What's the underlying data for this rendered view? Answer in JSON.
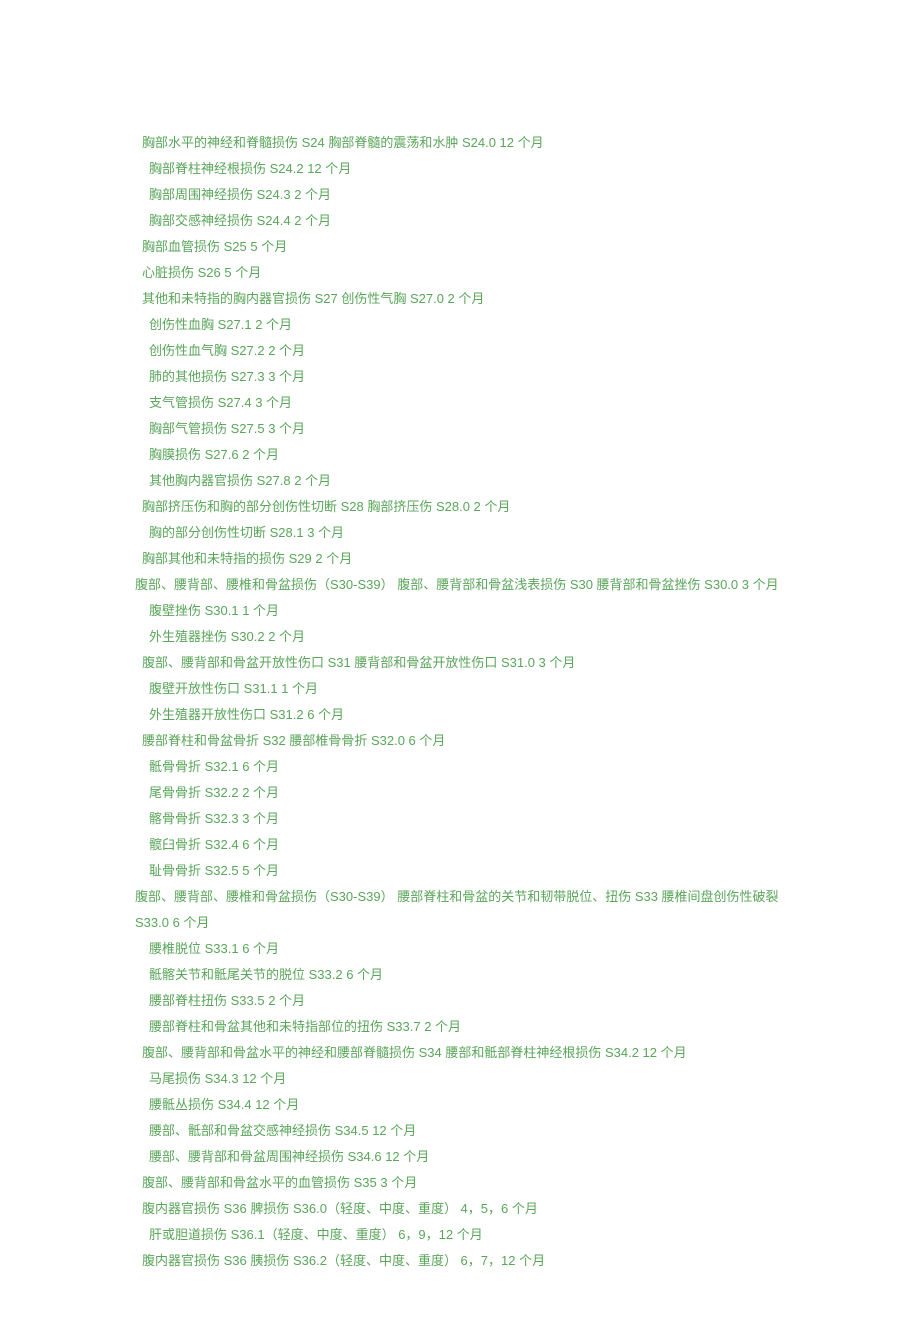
{
  "lines": [
    {
      "indent": 1,
      "parts": [
        "胸部水平的神经和脊髓损伤 S24 胸部脊髓的震荡和水肿 S24.0 12 个月"
      ]
    },
    {
      "indent": 2,
      "parts": [
        "胸部脊柱神经根损伤 S24.2 12 个月"
      ]
    },
    {
      "indent": 2,
      "parts": [
        "胸部周围神经损伤 S24.3 2 个月"
      ]
    },
    {
      "indent": 2,
      "parts": [
        "胸部交感神经损伤 S24.4 2 个月"
      ]
    },
    {
      "indent": 1,
      "parts": [
        "胸部血管损伤 S25 5 个月"
      ]
    },
    {
      "indent": 1,
      "parts": [
        "心脏损伤 S26 5 个月"
      ]
    },
    {
      "indent": 1,
      "parts": [
        "其他和未特指的胸内器官损伤 S27 创伤性气胸 S27.0 2 个月"
      ]
    },
    {
      "indent": 2,
      "parts": [
        "创伤性血胸 S27.1 2 个月"
      ]
    },
    {
      "indent": 2,
      "parts": [
        "创伤性血气胸 S27.2 2 个月"
      ]
    },
    {
      "indent": 2,
      "parts": [
        "肺的其他损伤 S27.3 3 个月"
      ]
    },
    {
      "indent": 2,
      "parts": [
        "支气管损伤 S27.4 3 个月"
      ]
    },
    {
      "indent": 2,
      "parts": [
        "胸部气管损伤 S27.5 3 个月"
      ]
    },
    {
      "indent": 2,
      "parts": [
        "胸膜损伤 S27.6 2 个月"
      ]
    },
    {
      "indent": 2,
      "parts": [
        "其他胸内器官损伤 S27.8 2 个月"
      ]
    },
    {
      "indent": 1,
      "parts": [
        "胸部挤压伤和胸的部分创伤性切断 S28 胸部挤压伤 S28.0 2 个月"
      ]
    },
    {
      "indent": 2,
      "parts": [
        "胸的部分创伤性切断 S28.1 3 个月"
      ]
    },
    {
      "indent": 1,
      "parts": [
        "胸部其他和未特指的损伤 S29 2 个月"
      ]
    },
    {
      "indent": 0,
      "parts": [
        "腹部、腰背部、腰椎和骨盆损伤（S30-S39） 腹部、腰背部和骨盆浅表损伤 S30 腰背部和骨盆挫伤 S30.0 3 个月"
      ]
    },
    {
      "indent": 2,
      "parts": [
        "腹壁挫伤 S30.1 1 个月"
      ]
    },
    {
      "indent": 2,
      "parts": [
        "外生殖器挫伤 S30.2 2 个月"
      ]
    },
    {
      "indent": 1,
      "parts": [
        "腹部、腰背部和骨盆开放性伤口 S31 腰背部和骨盆开放性伤口 S31.0 3 个月"
      ]
    },
    {
      "indent": 2,
      "parts": [
        "腹壁开放性伤口 S31.1 1 个月"
      ]
    },
    {
      "indent": 2,
      "parts": [
        "外生殖器开放性伤口 S31.2 6 个月"
      ]
    },
    {
      "indent": 1,
      "parts": [
        "腰部脊柱和骨盆骨折 S32 腰部椎骨骨折 S32.0 6 个月"
      ]
    },
    {
      "indent": 2,
      "parts": [
        "骶骨骨折 S32.1 6 个月"
      ]
    },
    {
      "indent": 2,
      "parts": [
        "尾骨骨折 S32.2 2 个月"
      ]
    },
    {
      "indent": 2,
      "parts": [
        "髂骨骨折 S32.3 3 个月"
      ]
    },
    {
      "indent": 2,
      "parts": [
        "髋臼骨折 S32.4 6 个月"
      ]
    },
    {
      "indent": 2,
      "parts": [
        "耻骨骨折 S32.5 5 个月"
      ]
    },
    {
      "indent": 0,
      "parts": [
        "腹部、腰背部、腰椎和骨盆损伤（S30-S39） 腰部脊柱和骨盆的关节和韧带脱位、扭伤 S33 腰椎间盘创伤性破裂"
      ]
    },
    {
      "indent": 0,
      "parts": [
        "S33.0 6 个月"
      ]
    },
    {
      "indent": 2,
      "parts": [
        "腰椎脱位 S33.1 6 个月"
      ]
    },
    {
      "indent": 2,
      "parts": [
        "骶髂关节和骶尾关节的脱位 S33.2 6 个月"
      ]
    },
    {
      "indent": 2,
      "parts": [
        "腰部脊柱扭伤 S33.5 2 个月"
      ]
    },
    {
      "indent": 2,
      "parts": [
        "腰部脊柱和骨盆其他和未特指部位的扭伤 S33.7 2 个月"
      ]
    },
    {
      "indent": 1,
      "parts": [
        "腹部、腰背部和骨盆水平的神经和腰部脊髓损伤 S34 腰部和骶部脊柱神经根损伤 S34.2 12 个月"
      ]
    },
    {
      "indent": 2,
      "parts": [
        "马尾损伤 S34.3 12 个月"
      ]
    },
    {
      "indent": 2,
      "parts": [
        "腰骶丛损伤 S34.4 12 个月"
      ]
    },
    {
      "indent": 2,
      "parts": [
        "腰部、骶部和骨盆交感神经损伤 S34.5 12 个月"
      ]
    },
    {
      "indent": 2,
      "parts": [
        "腰部、腰背部和骨盆周围神经损伤 S34.6 12 个月"
      ]
    },
    {
      "indent": 1,
      "parts": [
        "腹部、腰背部和骨盆水平的血管损伤 S35 3 个月"
      ]
    },
    {
      "indent": 1,
      "parts": [
        "腹内器官损伤 S36 脾损伤 S36.0（轻度、中度、重度） 4，5，6 个月"
      ]
    },
    {
      "indent": 2,
      "parts": [
        "肝或胆道损伤 S36.1（轻度、中度、重度） 6，9，12 个月"
      ]
    },
    {
      "indent": 1,
      "parts": [
        "腹内器官损伤 S36 胰损伤 S36.2（轻度、中度、重度） 6，7，12 个月"
      ]
    }
  ]
}
